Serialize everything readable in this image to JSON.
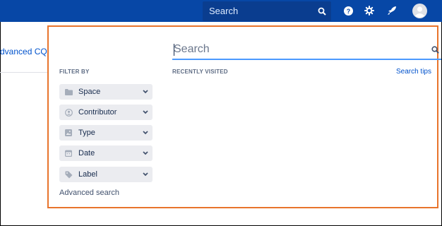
{
  "header": {
    "search_placeholder": "Search",
    "icons": [
      "search-icon",
      "help-icon",
      "settings-icon",
      "notifications-icon",
      "user-avatar-icon"
    ]
  },
  "background": {
    "link_text": "dvanced CQL"
  },
  "dialog": {
    "search_placeholder": "Search",
    "filter_by_label": "FILTER BY",
    "recently_visited_label": "RECENTLY VISITED",
    "search_tips_label": "Search tips",
    "filters": [
      {
        "label": "Space",
        "icon": "folder-icon"
      },
      {
        "label": "Contributor",
        "icon": "user-icon"
      },
      {
        "label": "Type",
        "icon": "image-icon"
      },
      {
        "label": "Date",
        "icon": "calendar-icon"
      },
      {
        "label": "Label",
        "icon": "tag-icon"
      }
    ],
    "advanced_search_label": "Advanced search"
  },
  "colors": {
    "topbar": "#0747a6",
    "accent_border": "#e8742c",
    "link": "#0052cc"
  }
}
